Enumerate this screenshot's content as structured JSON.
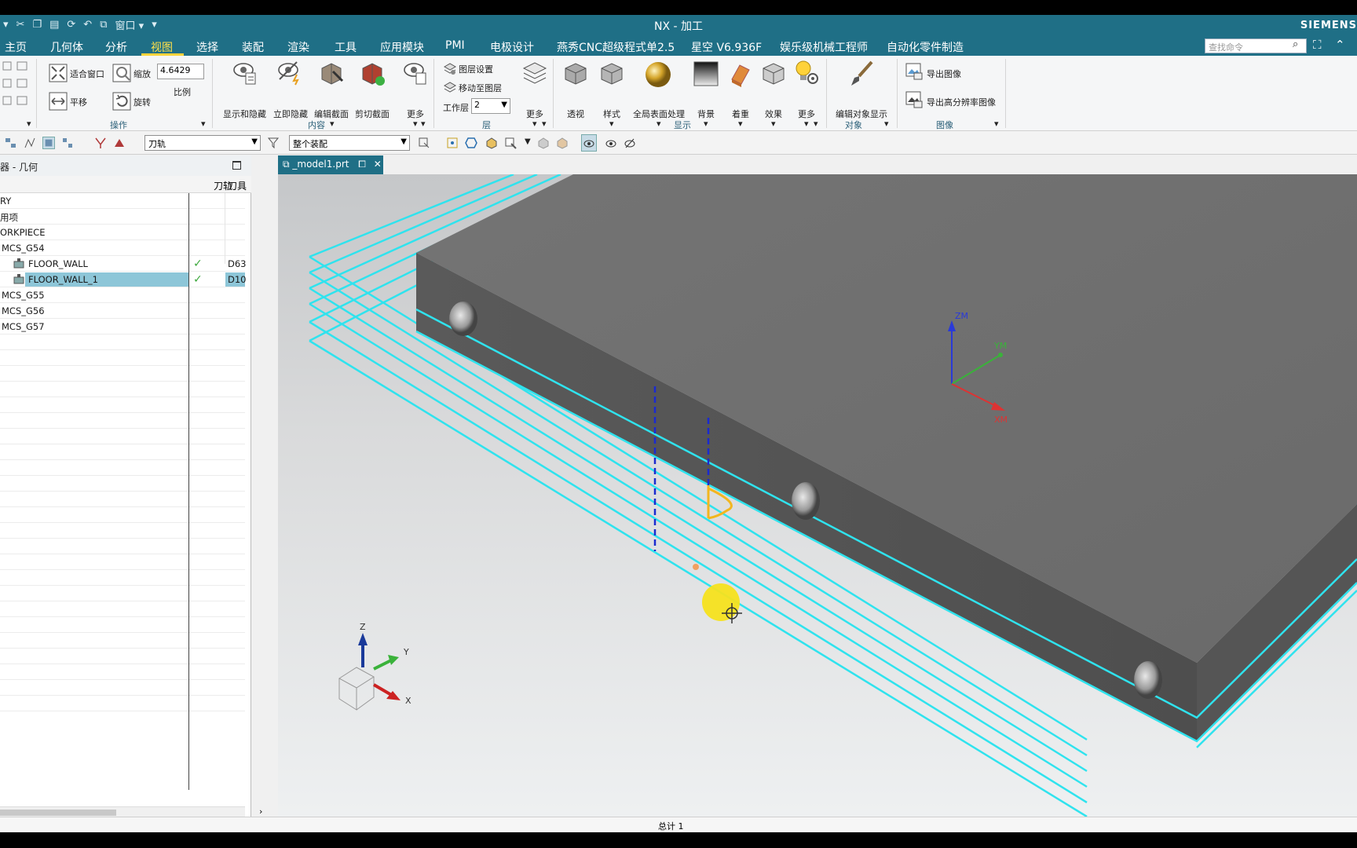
{
  "window": {
    "title": "NX - 加工",
    "brand": "SIEMENS"
  },
  "menu": {
    "items": [
      "主页",
      "几何体",
      "分析",
      "视图",
      "选择",
      "装配",
      "渲染",
      "工具",
      "应用模块",
      "PMI",
      "电极设计",
      "燕秀CNC超级程式单2.5",
      "星空 V6.936F",
      "娱乐级机械工程师",
      "自动化零件制造"
    ],
    "active": "视图",
    "search_placeholder": "查找命令"
  },
  "quick_access": {
    "window_label": "窗口"
  },
  "ribbon": {
    "operate": {
      "fit": "适合窗口",
      "zoom": "缩放",
      "pan": "平移",
      "rotate": "旋转",
      "scale_value": "4.6429",
      "scale_label": "比例",
      "group": "操作"
    },
    "content": {
      "show_hide": "显示和隐藏",
      "instant_hide": "立即隐藏",
      "edit_section": "编辑截面",
      "clip_section": "剪切截面",
      "more": "更多",
      "group": "内容"
    },
    "layer": {
      "layer_settings": "图层设置",
      "move_to_layer": "移动至图层",
      "work_layer_label": "工作层",
      "work_layer_value": "2",
      "more": "更多",
      "group": "层"
    },
    "display": {
      "perspective": "透视",
      "style": "样式",
      "global_surface": "全局表面处理",
      "background": "背景",
      "shading": "着重",
      "effects": "效果",
      "more": "更多",
      "group": "显示"
    },
    "object": {
      "edit_display": "编辑对象显示",
      "group": "对象"
    },
    "image": {
      "export_image": "导出图像",
      "export_hires": "导出高分辨率图像",
      "group": "图像"
    }
  },
  "toolbar2": {
    "filter_value": "刀轨",
    "scope_value": "整个装配"
  },
  "navigator": {
    "title": "器 - 几何",
    "col_path": "刀轨",
    "col_tool": "刀具",
    "rows": [
      {
        "name": "RY",
        "path": "",
        "tool": ""
      },
      {
        "name": "用项",
        "path": "",
        "tool": ""
      },
      {
        "name": "ORKPIECE",
        "path": "",
        "tool": ""
      },
      {
        "name": "MCS_G54",
        "path": "",
        "tool": ""
      },
      {
        "name": "FLOOR_WALL",
        "path": "✓",
        "tool": "D63"
      },
      {
        "name": "FLOOR_WALL_1",
        "path": "✓",
        "tool": "D10"
      },
      {
        "name": "MCS_G55",
        "path": "",
        "tool": ""
      },
      {
        "name": "MCS_G56",
        "path": "",
        "tool": ""
      },
      {
        "name": "MCS_G57",
        "path": "",
        "tool": ""
      }
    ]
  },
  "viewport": {
    "tab_label": "_model1.prt",
    "axes": {
      "zm": "ZM",
      "ym": "YM",
      "xm": "XM",
      "z": "Z",
      "y": "Y",
      "x": "X"
    }
  },
  "status": {
    "total": "总计 1"
  },
  "colors": {
    "accent": "#1f6f86",
    "toolpath": "#2fe3ee",
    "selection": "#8dc6d8"
  }
}
